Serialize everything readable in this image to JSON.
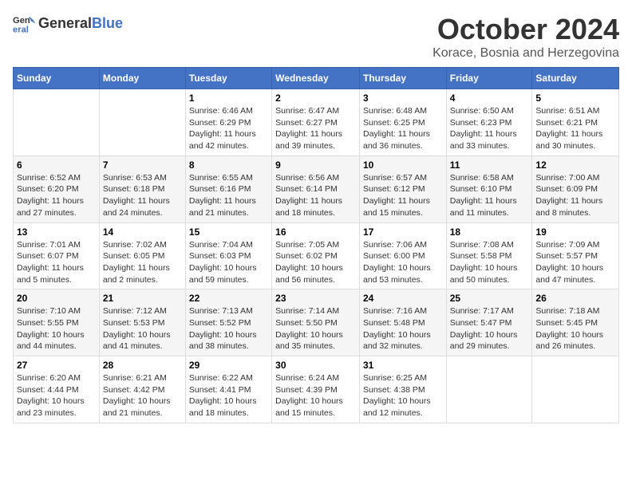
{
  "header": {
    "logo_line1": "General",
    "logo_line2": "Blue",
    "month": "October 2024",
    "location": "Korace, Bosnia and Herzegovina"
  },
  "weekdays": [
    "Sunday",
    "Monday",
    "Tuesday",
    "Wednesday",
    "Thursday",
    "Friday",
    "Saturday"
  ],
  "weeks": [
    [
      {
        "day": "",
        "info": ""
      },
      {
        "day": "",
        "info": ""
      },
      {
        "day": "1",
        "info": "Sunrise: 6:46 AM\nSunset: 6:29 PM\nDaylight: 11 hours and 42 minutes."
      },
      {
        "day": "2",
        "info": "Sunrise: 6:47 AM\nSunset: 6:27 PM\nDaylight: 11 hours and 39 minutes."
      },
      {
        "day": "3",
        "info": "Sunrise: 6:48 AM\nSunset: 6:25 PM\nDaylight: 11 hours and 36 minutes."
      },
      {
        "day": "4",
        "info": "Sunrise: 6:50 AM\nSunset: 6:23 PM\nDaylight: 11 hours and 33 minutes."
      },
      {
        "day": "5",
        "info": "Sunrise: 6:51 AM\nSunset: 6:21 PM\nDaylight: 11 hours and 30 minutes."
      }
    ],
    [
      {
        "day": "6",
        "info": "Sunrise: 6:52 AM\nSunset: 6:20 PM\nDaylight: 11 hours and 27 minutes."
      },
      {
        "day": "7",
        "info": "Sunrise: 6:53 AM\nSunset: 6:18 PM\nDaylight: 11 hours and 24 minutes."
      },
      {
        "day": "8",
        "info": "Sunrise: 6:55 AM\nSunset: 6:16 PM\nDaylight: 11 hours and 21 minutes."
      },
      {
        "day": "9",
        "info": "Sunrise: 6:56 AM\nSunset: 6:14 PM\nDaylight: 11 hours and 18 minutes."
      },
      {
        "day": "10",
        "info": "Sunrise: 6:57 AM\nSunset: 6:12 PM\nDaylight: 11 hours and 15 minutes."
      },
      {
        "day": "11",
        "info": "Sunrise: 6:58 AM\nSunset: 6:10 PM\nDaylight: 11 hours and 11 minutes."
      },
      {
        "day": "12",
        "info": "Sunrise: 7:00 AM\nSunset: 6:09 PM\nDaylight: 11 hours and 8 minutes."
      }
    ],
    [
      {
        "day": "13",
        "info": "Sunrise: 7:01 AM\nSunset: 6:07 PM\nDaylight: 11 hours and 5 minutes."
      },
      {
        "day": "14",
        "info": "Sunrise: 7:02 AM\nSunset: 6:05 PM\nDaylight: 11 hours and 2 minutes."
      },
      {
        "day": "15",
        "info": "Sunrise: 7:04 AM\nSunset: 6:03 PM\nDaylight: 10 hours and 59 minutes."
      },
      {
        "day": "16",
        "info": "Sunrise: 7:05 AM\nSunset: 6:02 PM\nDaylight: 10 hours and 56 minutes."
      },
      {
        "day": "17",
        "info": "Sunrise: 7:06 AM\nSunset: 6:00 PM\nDaylight: 10 hours and 53 minutes."
      },
      {
        "day": "18",
        "info": "Sunrise: 7:08 AM\nSunset: 5:58 PM\nDaylight: 10 hours and 50 minutes."
      },
      {
        "day": "19",
        "info": "Sunrise: 7:09 AM\nSunset: 5:57 PM\nDaylight: 10 hours and 47 minutes."
      }
    ],
    [
      {
        "day": "20",
        "info": "Sunrise: 7:10 AM\nSunset: 5:55 PM\nDaylight: 10 hours and 44 minutes."
      },
      {
        "day": "21",
        "info": "Sunrise: 7:12 AM\nSunset: 5:53 PM\nDaylight: 10 hours and 41 minutes."
      },
      {
        "day": "22",
        "info": "Sunrise: 7:13 AM\nSunset: 5:52 PM\nDaylight: 10 hours and 38 minutes."
      },
      {
        "day": "23",
        "info": "Sunrise: 7:14 AM\nSunset: 5:50 PM\nDaylight: 10 hours and 35 minutes."
      },
      {
        "day": "24",
        "info": "Sunrise: 7:16 AM\nSunset: 5:48 PM\nDaylight: 10 hours and 32 minutes."
      },
      {
        "day": "25",
        "info": "Sunrise: 7:17 AM\nSunset: 5:47 PM\nDaylight: 10 hours and 29 minutes."
      },
      {
        "day": "26",
        "info": "Sunrise: 7:18 AM\nSunset: 5:45 PM\nDaylight: 10 hours and 26 minutes."
      }
    ],
    [
      {
        "day": "27",
        "info": "Sunrise: 6:20 AM\nSunset: 4:44 PM\nDaylight: 10 hours and 23 minutes."
      },
      {
        "day": "28",
        "info": "Sunrise: 6:21 AM\nSunset: 4:42 PM\nDaylight: 10 hours and 21 minutes."
      },
      {
        "day": "29",
        "info": "Sunrise: 6:22 AM\nSunset: 4:41 PM\nDaylight: 10 hours and 18 minutes."
      },
      {
        "day": "30",
        "info": "Sunrise: 6:24 AM\nSunset: 4:39 PM\nDaylight: 10 hours and 15 minutes."
      },
      {
        "day": "31",
        "info": "Sunrise: 6:25 AM\nSunset: 4:38 PM\nDaylight: 10 hours and 12 minutes."
      },
      {
        "day": "",
        "info": ""
      },
      {
        "day": "",
        "info": ""
      }
    ]
  ]
}
